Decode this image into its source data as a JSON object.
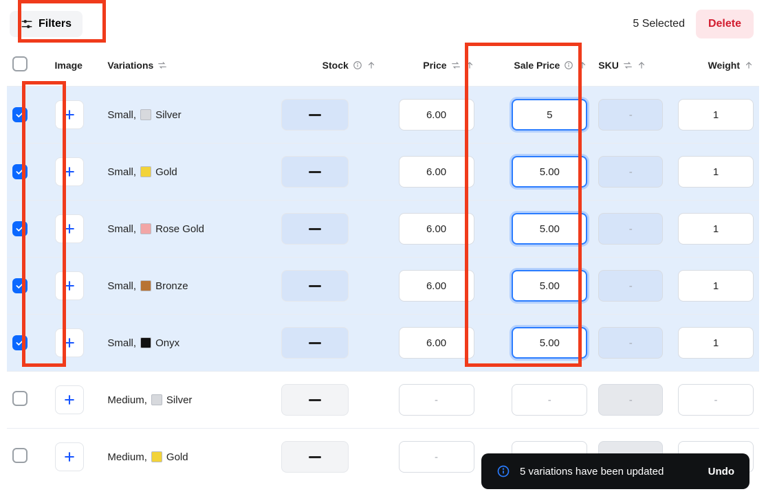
{
  "toolbar": {
    "filters_label": "Filters",
    "selected_count": "5 Selected",
    "delete_label": "Delete"
  },
  "columns": {
    "image": "Image",
    "variations": "Variations",
    "stock": "Stock",
    "price": "Price",
    "sale_price": "Sale Price",
    "sku": "SKU",
    "weight": "Weight"
  },
  "swatch_colors": {
    "silver": "#d7d9dd",
    "gold": "#f2d33a",
    "rose_gold": "#f2a6a6",
    "bronze": "#b87333",
    "onyx": "#111111"
  },
  "rows": [
    {
      "selected": true,
      "size": "Small,",
      "color_key": "silver",
      "color_name": "Silver",
      "price": "6.00",
      "sale_price": "5",
      "sku": "-",
      "weight": "1"
    },
    {
      "selected": true,
      "size": "Small,",
      "color_key": "gold",
      "color_name": "Gold",
      "price": "6.00",
      "sale_price": "5.00",
      "sku": "-",
      "weight": "1"
    },
    {
      "selected": true,
      "size": "Small,",
      "color_key": "rose_gold",
      "color_name": "Rose Gold",
      "price": "6.00",
      "sale_price": "5.00",
      "sku": "-",
      "weight": "1"
    },
    {
      "selected": true,
      "size": "Small,",
      "color_key": "bronze",
      "color_name": "Bronze",
      "price": "6.00",
      "sale_price": "5.00",
      "sku": "-",
      "weight": "1"
    },
    {
      "selected": true,
      "size": "Small,",
      "color_key": "onyx",
      "color_name": "Onyx",
      "price": "6.00",
      "sale_price": "5.00",
      "sku": "-",
      "weight": "1"
    },
    {
      "selected": false,
      "size": "Medium,",
      "color_key": "silver",
      "color_name": "Silver",
      "price": "-",
      "sale_price": "-",
      "sku": "-",
      "weight": "-"
    },
    {
      "selected": false,
      "size": "Medium,",
      "color_key": "gold",
      "color_name": "Gold",
      "price": "-",
      "sale_price": "-",
      "sku": "-",
      "weight": "-"
    }
  ],
  "toast": {
    "message": "5 variations have been updated",
    "undo_label": "Undo"
  }
}
